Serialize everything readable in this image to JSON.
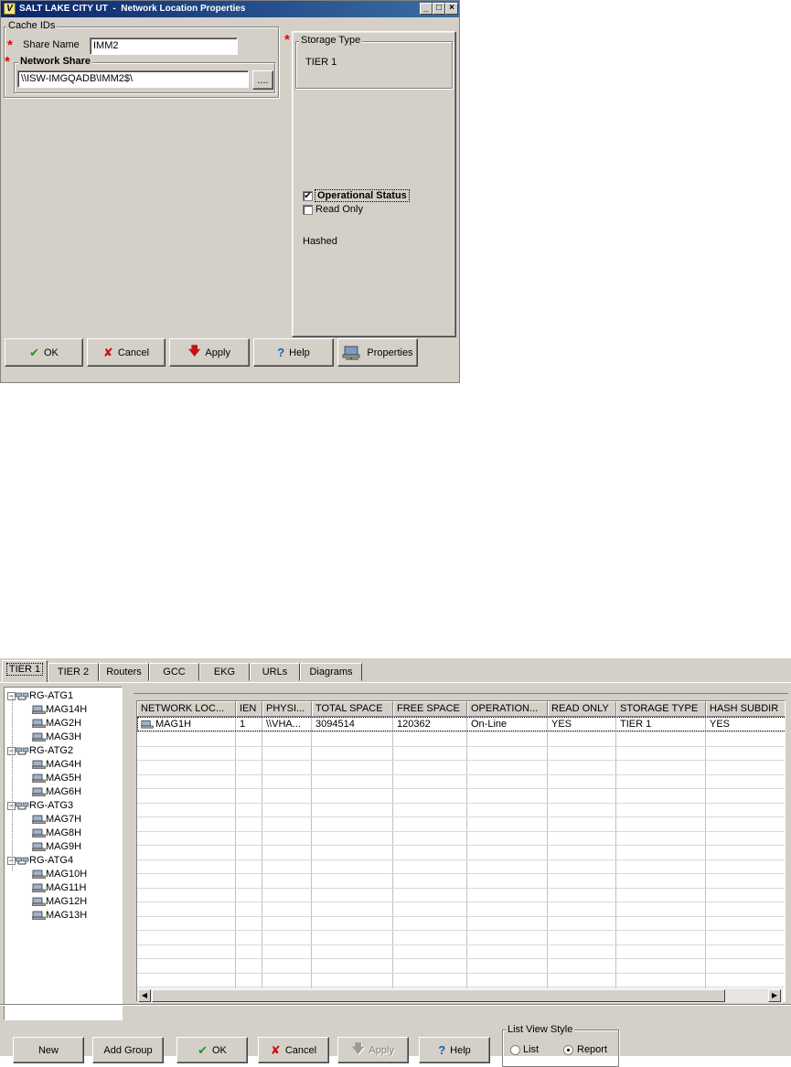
{
  "dialog1": {
    "title": "SALT LAKE CITY UT  -  Network Location Properties",
    "window_controls": [
      "_",
      "□",
      "×"
    ],
    "cache_ids": {
      "legend": "Cache IDs",
      "share_name_label": "Share Name",
      "share_name_value": "IMM2",
      "network_share_legend": "Network Share",
      "network_share_value": "\\\\ISW-IMGQADB\\IMM2$\\",
      "browse_label": "...."
    },
    "required_marker": "*",
    "storage_type": {
      "legend": "Storage Type",
      "value": "TIER 1"
    },
    "operational_status": {
      "label": "Operational Status",
      "checked": true
    },
    "read_only": {
      "label": "Read Only",
      "checked": false
    },
    "hashed_label": "Hashed",
    "buttons": {
      "ok": "OK",
      "cancel": "Cancel",
      "apply": "Apply",
      "help": "Help",
      "properties": "Properties"
    }
  },
  "dialog2": {
    "tabs": [
      "TIER 1",
      "TIER 2",
      "Routers",
      "GCC",
      "EKG",
      "URLs",
      "Diagrams"
    ],
    "active_tab": "TIER 1",
    "tree": [
      {
        "group": "RG-ATG1",
        "items": [
          "MAG14H",
          "MAG2H",
          "MAG3H"
        ]
      },
      {
        "group": "RG-ATG2",
        "items": [
          "MAG4H",
          "MAG5H",
          "MAG6H"
        ]
      },
      {
        "group": "RG-ATG3",
        "items": [
          "MAG7H",
          "MAG8H",
          "MAG9H"
        ]
      },
      {
        "group": "RG-ATG4",
        "items": [
          "MAG10H",
          "MAG11H",
          "MAG12H",
          "MAG13H"
        ]
      }
    ],
    "tree_toggle": "−",
    "grid": {
      "columns": [
        "NETWORK LOC...",
        "IEN",
        "PHYSI...",
        "TOTAL SPACE",
        "FREE SPACE",
        "OPERATION...",
        "READ ONLY",
        "STORAGE TYPE",
        "HASH SUBDIR"
      ],
      "rows": [
        [
          "MAG1H",
          "1",
          "\\\\VHA...",
          "3094514",
          "120362",
          "On-Line",
          "YES",
          "TIER 1",
          "YES"
        ]
      ]
    },
    "buttons": {
      "new": "New",
      "add_group": "Add Group",
      "ok": "OK",
      "cancel": "Cancel",
      "apply": "Apply",
      "help": "Help"
    },
    "list_view_style": {
      "legend": "List View Style",
      "options": [
        "List",
        "Report"
      ],
      "selected": "Report"
    }
  },
  "icons": {
    "check": "✔",
    "x": "✘",
    "down_arrow": "🡇",
    "help": "?",
    "checkmark": "✔",
    "scroll_left": "◀",
    "scroll_right": "▶"
  }
}
